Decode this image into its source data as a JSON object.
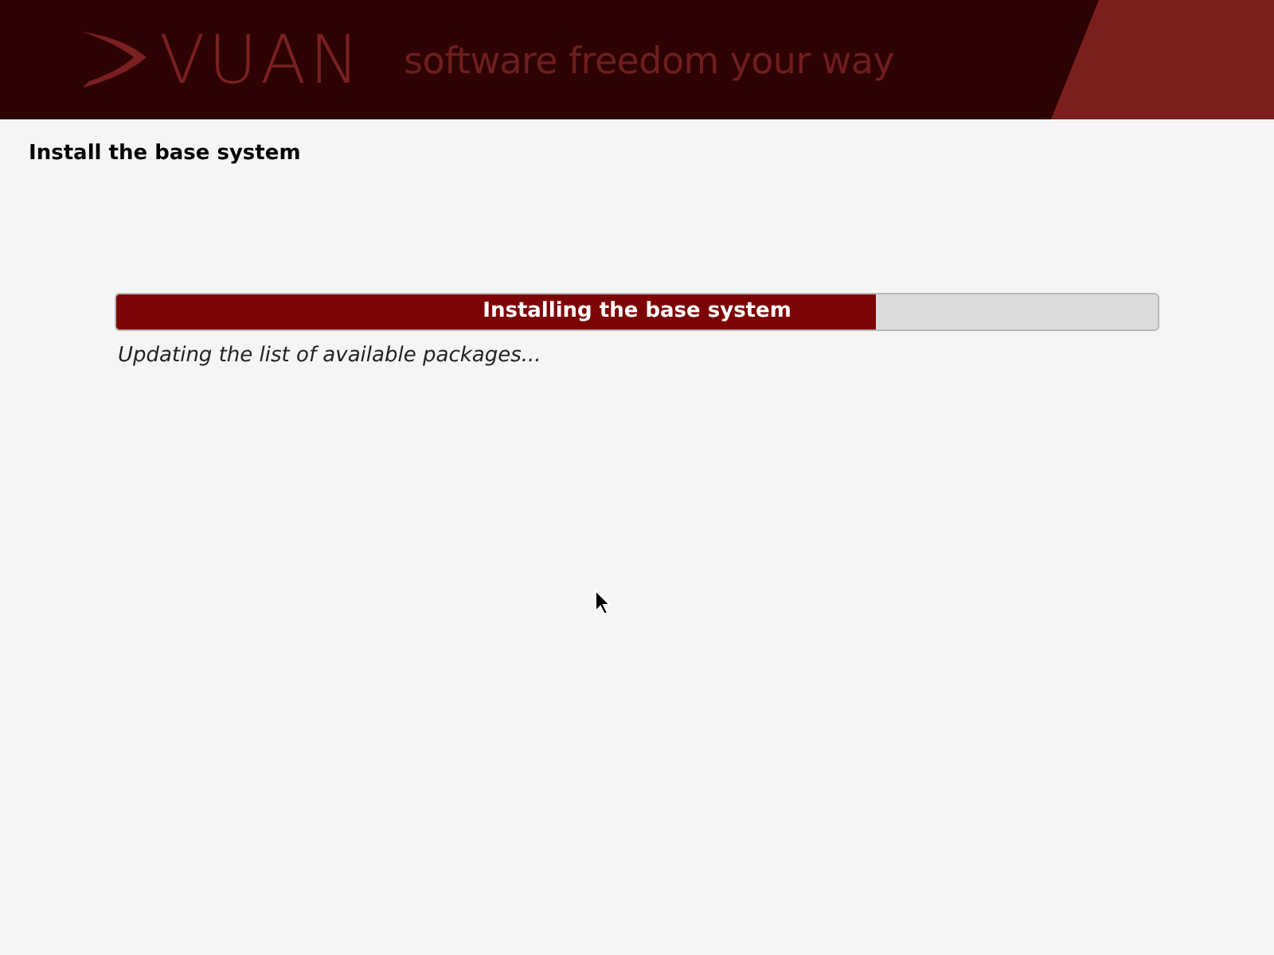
{
  "header": {
    "logo": "VUAN",
    "tagline": "software freedom your way"
  },
  "step_title": "Install the base system",
  "progress": {
    "label": "Installing the base system",
    "level": 0.73
  },
  "status": "Updating the list of available packages..."
}
